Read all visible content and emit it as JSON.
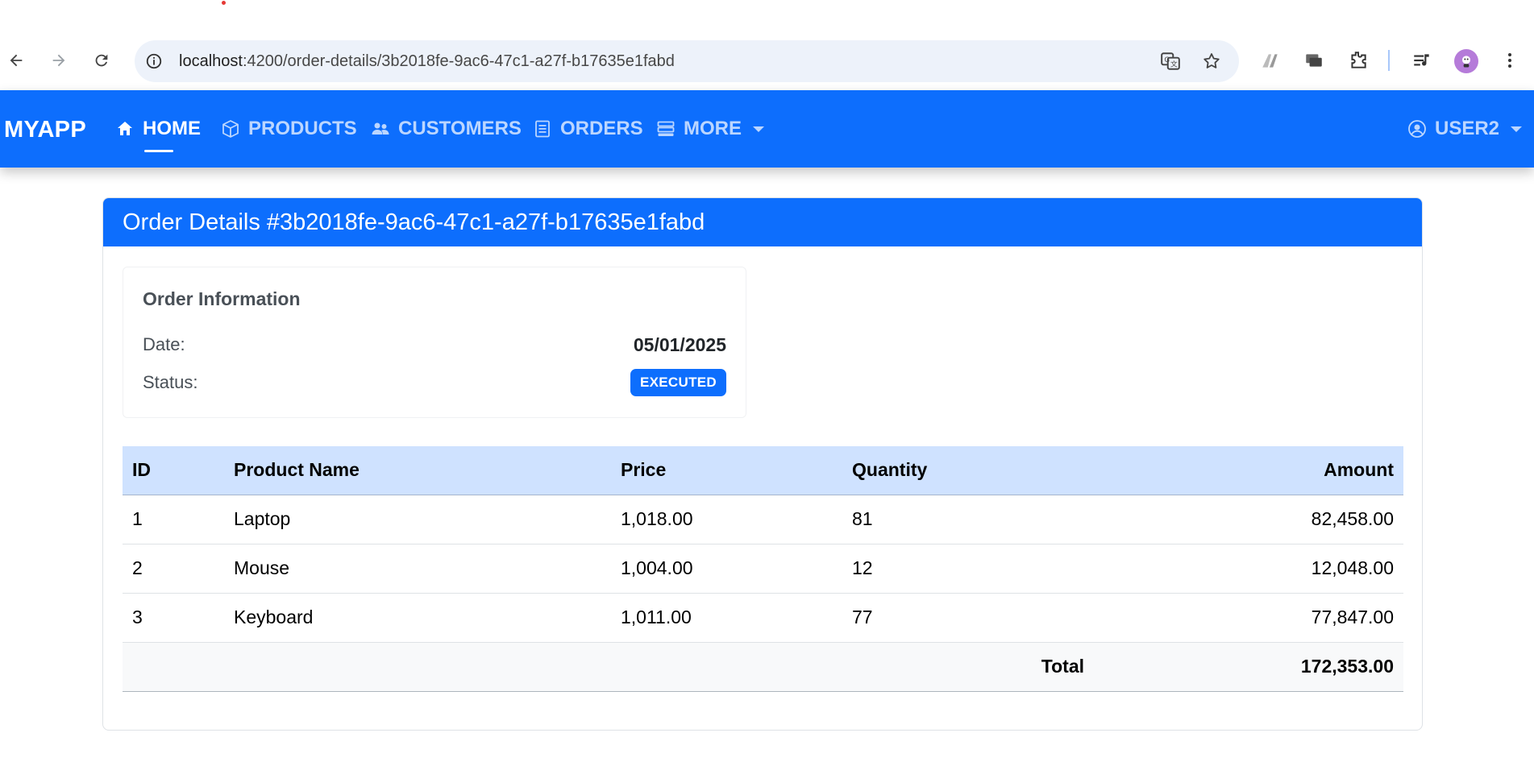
{
  "browser": {
    "url_host": "localhost",
    "url_path": ":4200/order-details/3b2018fe-9ac6-47c1-a27f-b17635e1fabd"
  },
  "navbar": {
    "brand": "MYAPP",
    "items": [
      {
        "label": "HOME",
        "icon": "home-icon",
        "active": true
      },
      {
        "label": "PRODUCTS",
        "icon": "box-icon"
      },
      {
        "label": "CUSTOMERS",
        "icon": "users-icon"
      },
      {
        "label": "ORDERS",
        "icon": "document-icon"
      },
      {
        "label": "MORE",
        "icon": "stack-icon"
      }
    ],
    "user": "USER2"
  },
  "order": {
    "title": "Order Details #3b2018fe-9ac6-47c1-a27f-b17635e1fabd",
    "info_heading": "Order Information",
    "date_label": "Date:",
    "date_value": "05/01/2025",
    "status_label": "Status:",
    "status_value": "EXECUTED"
  },
  "table": {
    "headers": [
      "ID",
      "Product Name",
      "Price",
      "Quantity",
      "Amount"
    ],
    "rows": [
      {
        "id": "1",
        "name": "Laptop",
        "price": "1,018.00",
        "qty": "81",
        "amount": "82,458.00"
      },
      {
        "id": "2",
        "name": "Mouse",
        "price": "1,004.00",
        "qty": "12",
        "amount": "12,048.00"
      },
      {
        "id": "3",
        "name": "Keyboard",
        "price": "1,011.00",
        "qty": "77",
        "amount": "77,847.00"
      }
    ],
    "total_label": "Total",
    "total_value": "172,353.00"
  },
  "colors": {
    "primary": "#0d6efd",
    "table_header": "#cfe2ff"
  }
}
